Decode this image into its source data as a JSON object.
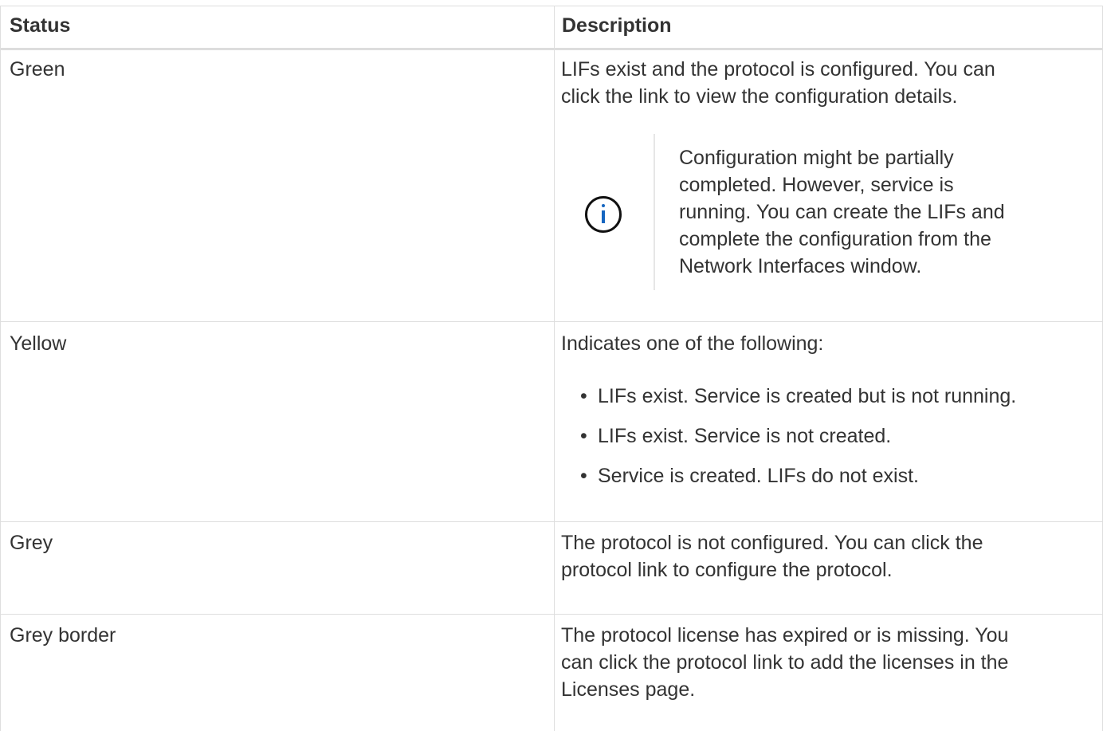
{
  "table": {
    "headers": {
      "status": "Status",
      "description": "Description"
    },
    "rows": [
      {
        "status": "Green",
        "description": [
          "LIFs exist and the protocol is configured. You can",
          "click the link to view the configuration details."
        ],
        "note": {
          "icon": "info-icon",
          "text": [
            "Configuration might be partially",
            "completed. However, service is",
            "running. You can create the LIFs and",
            "complete the configuration from the",
            "Network Interfaces window."
          ]
        }
      },
      {
        "status": "Yellow",
        "description": [
          "Indicates one of the following:"
        ],
        "bullets": [
          "LIFs exist. Service is created but is not running.",
          "LIFs exist. Service is not created.",
          "Service is created. LIFs do not exist."
        ]
      },
      {
        "status": "Grey",
        "description": [
          "The protocol is not configured. You can click the",
          "protocol link to configure the protocol."
        ]
      },
      {
        "status": "Grey border",
        "description": [
          "The protocol license has expired or is missing. You",
          "can click the protocol link to add the licenses in the",
          "Licenses page."
        ]
      }
    ]
  },
  "colors": {
    "text": "#333333",
    "grid": "#dedede",
    "info_icon_accent": "#1565c0"
  }
}
